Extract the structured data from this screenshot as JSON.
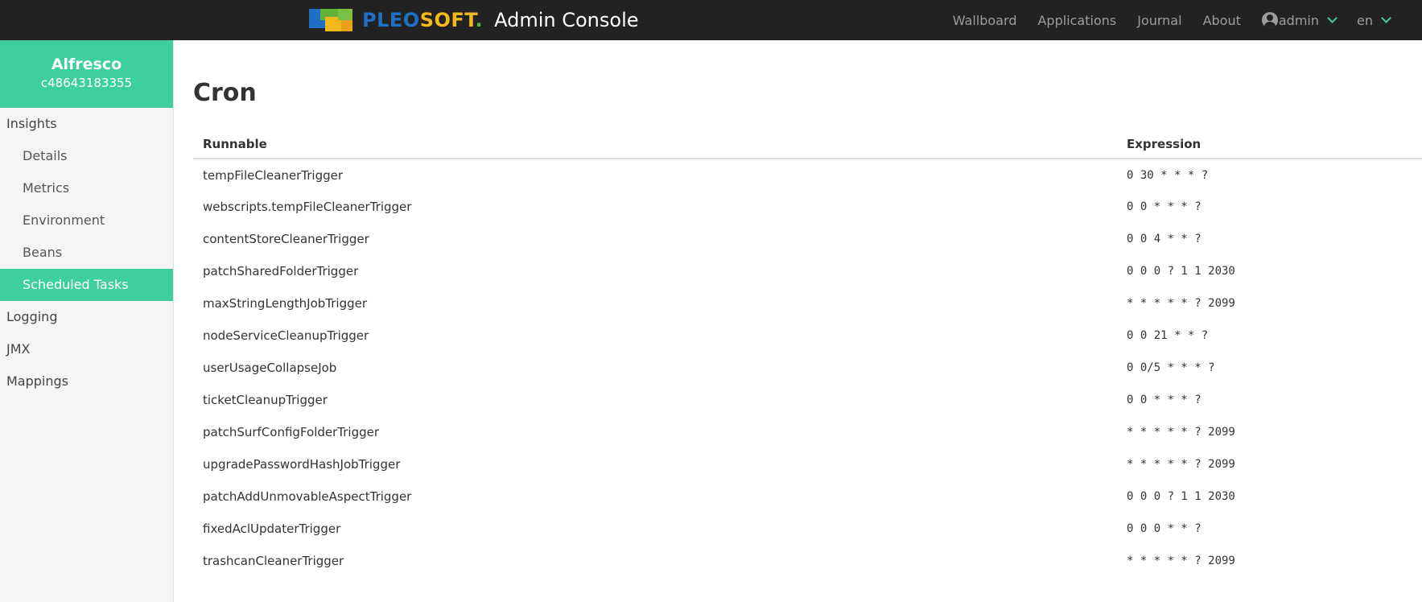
{
  "header": {
    "logo_part1": "PLEO",
    "logo_part2": "SOFT",
    "logo_dot": ".",
    "title": "Admin Console",
    "nav": [
      "Wallboard",
      "Applications",
      "Journal",
      "About"
    ],
    "user": "admin",
    "language": "en",
    "accent_color": "#3ecf9e"
  },
  "sidebar": {
    "app_name": "Alfresco",
    "app_id": "c48643183355",
    "items": [
      {
        "label": "Insights"
      },
      {
        "label": "Details"
      },
      {
        "label": "Metrics"
      },
      {
        "label": "Environment"
      },
      {
        "label": "Beans"
      },
      {
        "label": "Scheduled Tasks",
        "active": true
      },
      {
        "label": "Logging"
      },
      {
        "label": "JMX"
      },
      {
        "label": "Mappings"
      }
    ]
  },
  "main": {
    "title": "Cron",
    "columns": [
      "Runnable",
      "Expression"
    ],
    "rows": [
      {
        "runnable": "tempFileCleanerTrigger",
        "expression": "0 30 * * * ?"
      },
      {
        "runnable": "webscripts.tempFileCleanerTrigger",
        "expression": "0 0 * * * ?"
      },
      {
        "runnable": "contentStoreCleanerTrigger",
        "expression": "0 0 4 * * ?"
      },
      {
        "runnable": "patchSharedFolderTrigger",
        "expression": "0 0 0 ? 1 1 2030"
      },
      {
        "runnable": "maxStringLengthJobTrigger",
        "expression": "* * * * * ? 2099"
      },
      {
        "runnable": "nodeServiceCleanupTrigger",
        "expression": "0 0 21 * * ?"
      },
      {
        "runnable": "userUsageCollapseJob",
        "expression": "0 0/5 * * * ?"
      },
      {
        "runnable": "ticketCleanupTrigger",
        "expression": "0 0 * * * ?"
      },
      {
        "runnable": "patchSurfConfigFolderTrigger",
        "expression": "* * * * * ? 2099"
      },
      {
        "runnable": "upgradePasswordHashJobTrigger",
        "expression": "* * * * * ? 2099"
      },
      {
        "runnable": "patchAddUnmovableAspectTrigger",
        "expression": "0 0 0 ? 1 1 2030"
      },
      {
        "runnable": "fixedAclUpdaterTrigger",
        "expression": "0 0 0 * * ?"
      },
      {
        "runnable": "trashcanCleanerTrigger",
        "expression": "* * * * * ? 2099"
      }
    ]
  }
}
